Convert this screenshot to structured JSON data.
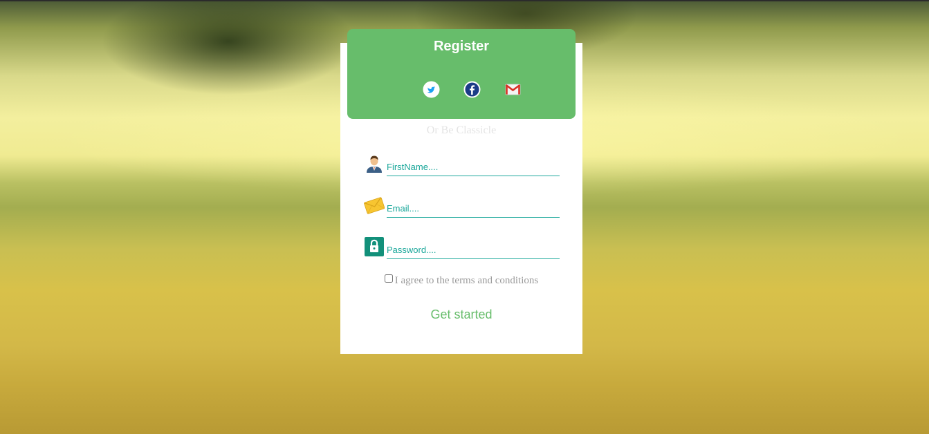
{
  "header": {
    "title": "Register"
  },
  "social": [
    {
      "icon": "twitter-icon"
    },
    {
      "icon": "facebook-icon"
    },
    {
      "icon": "gmail-icon"
    }
  ],
  "divider_text": "Or Be Classicle",
  "form": {
    "firstname": {
      "placeholder": "FirstName....",
      "value": "",
      "icon": "user-icon"
    },
    "email": {
      "placeholder": "Email....",
      "value": "",
      "icon": "envelope-icon"
    },
    "password": {
      "placeholder": "Password....",
      "value": "",
      "icon": "lock-icon"
    }
  },
  "terms": {
    "label": "I agree to the terms and conditions",
    "checked": false
  },
  "cta": {
    "label": "Get started"
  },
  "colors": {
    "accent": "#67bd6b",
    "field": "#1aa79a"
  }
}
